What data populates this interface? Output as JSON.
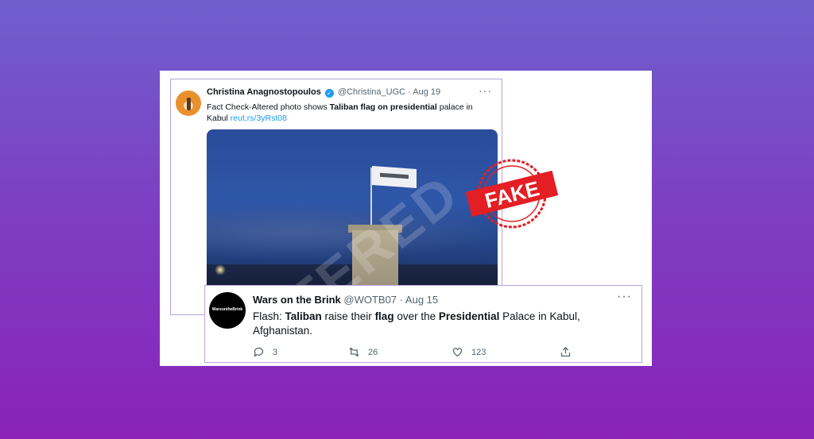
{
  "tweet1": {
    "name": "Christina Anagnostopoulos",
    "handle": "@Christina_UGC",
    "separator": "·",
    "date": "Aug 19",
    "text": {
      "part1": "Fact Check-Altered photo shows ",
      "bold1": "Taliban flag on presidential",
      "part2": " palace in Kabul ",
      "link": "reut.rs/3yRst08"
    },
    "watermark": "TERED"
  },
  "stamp": {
    "text": "FAKE",
    "color": "#e31e24"
  },
  "tweet2": {
    "name": "Wars on the Brink",
    "handle": "@WOTB07",
    "separator": "·",
    "date": "Aug 15",
    "avatar_text": "WarsontheBrink",
    "text": {
      "p1": "Flash: ",
      "b1": "Taliban",
      "p2": " raise their ",
      "b2": "flag",
      "p3": " over the ",
      "b3": "Presidential",
      "p4": " Palace in Kabul, Afghanistan."
    },
    "actions": {
      "replies": "3",
      "retweets": "26",
      "likes": "123"
    }
  },
  "colors": {
    "accent": "#1d9bf0",
    "frame": "#b9a4dd"
  }
}
